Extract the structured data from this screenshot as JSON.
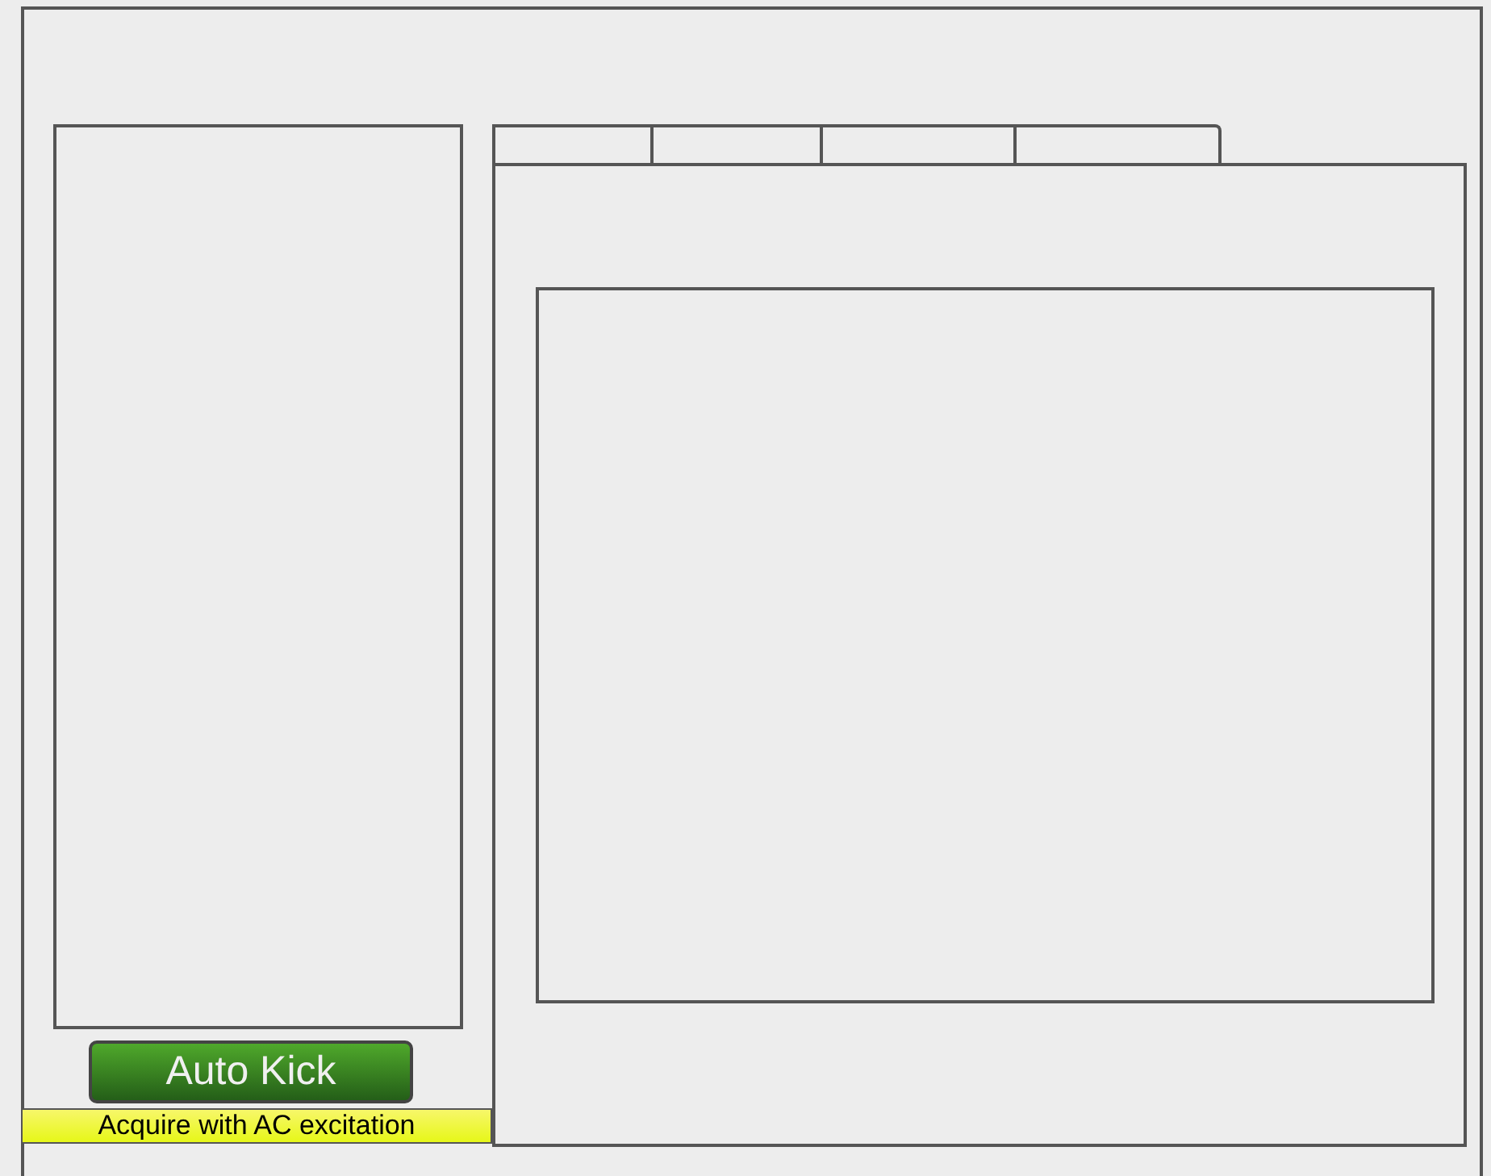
{
  "tabs": [
    {
      "kind": "tab"
    },
    {
      "kind": "tab"
    },
    {
      "kind": "tab"
    },
    {
      "kind": "tab"
    }
  ],
  "auto_kick_button": {
    "label": "Auto Kick"
  },
  "status_label": {
    "text": "Acquire with AC excitation"
  }
}
